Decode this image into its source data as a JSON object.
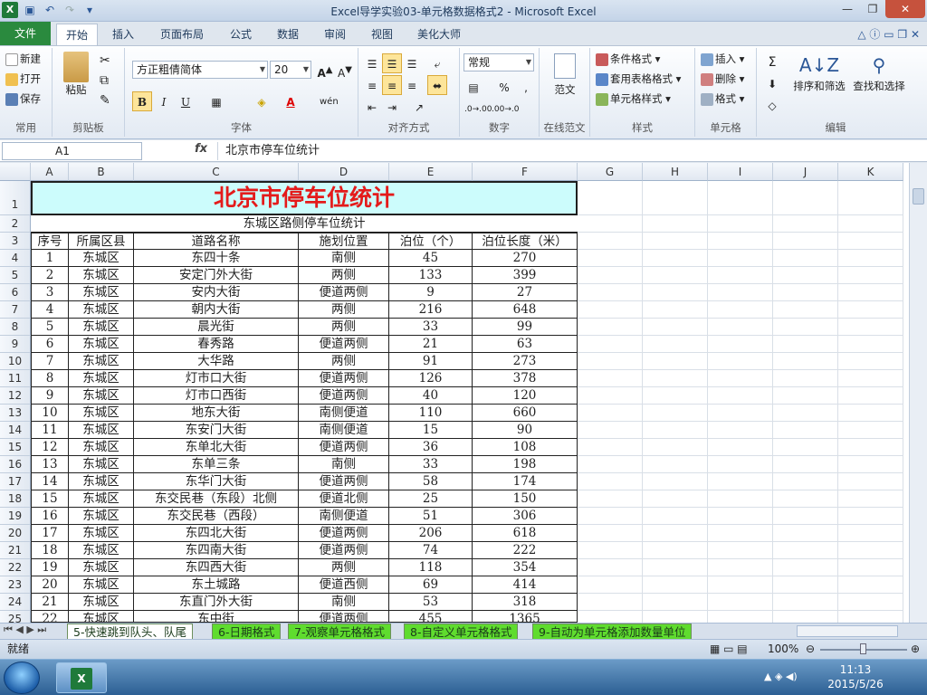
{
  "window": {
    "title": "Excel导学实验03-单元格数据格式2 - Microsoft Excel",
    "quick_access": [
      "save-icon",
      "undo-icon",
      "redo-icon",
      "customize-icon"
    ]
  },
  "tabs": [
    "文件",
    "开始",
    "插入",
    "页面布局",
    "公式",
    "数据",
    "审阅",
    "视图",
    "美化大师"
  ],
  "ribbon": {
    "clipboard": {
      "new": "新建",
      "open": "打开",
      "save": "保存",
      "paste": "粘贴",
      "label": "剪贴板",
      "common": "常用"
    },
    "font": {
      "name": "方正粗倩简体",
      "size": "20",
      "label": "字体",
      "bold": "B",
      "italic": "I",
      "underline": "U"
    },
    "alignment": {
      "label": "对齐方式"
    },
    "number": {
      "format": "常规",
      "label": "数字",
      "percent": "%",
      "comma": ","
    },
    "online": {
      "button": "范文",
      "label": "在线范文"
    },
    "styles": {
      "cond": "条件格式",
      "table": "套用表格格式",
      "cell": "单元格样式",
      "label": "样式"
    },
    "cells": {
      "insert": "插入",
      "delete": "删除",
      "format": "格式",
      "label": "单元格"
    },
    "editing": {
      "sort": "排序和筛选",
      "find": "查找和选择",
      "label": "编辑"
    }
  },
  "formula_bar": {
    "name_box": "A1",
    "fx": "fx",
    "content": "北京市停车位统计"
  },
  "columns": [
    "A",
    "B",
    "C",
    "D",
    "E",
    "F",
    "G",
    "H",
    "I",
    "J",
    "K"
  ],
  "sheet": {
    "title": "北京市停车位统计",
    "subtitle": "东城区路侧停车位统计",
    "headers": [
      "序号",
      "所属区县",
      "道路名称",
      "施划位置",
      "泊位（个）",
      "泊位长度（米）"
    ],
    "rows": [
      [
        "1",
        "东城区",
        "东四十条",
        "南侧",
        "45",
        "270"
      ],
      [
        "2",
        "东城区",
        "安定门外大街",
        "两侧",
        "133",
        "399"
      ],
      [
        "3",
        "东城区",
        "安内大街",
        "便道两侧",
        "9",
        "27"
      ],
      [
        "4",
        "东城区",
        "朝内大街",
        "两侧",
        "216",
        "648"
      ],
      [
        "5",
        "东城区",
        "晨光街",
        "两侧",
        "33",
        "99"
      ],
      [
        "6",
        "东城区",
        "春秀路",
        "便道两侧",
        "21",
        "63"
      ],
      [
        "7",
        "东城区",
        "大华路",
        "两侧",
        "91",
        "273"
      ],
      [
        "8",
        "东城区",
        "灯市口大街",
        "便道两侧",
        "126",
        "378"
      ],
      [
        "9",
        "东城区",
        "灯市口西街",
        "便道两侧",
        "40",
        "120"
      ],
      [
        "10",
        "东城区",
        "地东大街",
        "南侧便道",
        "110",
        "660"
      ],
      [
        "11",
        "东城区",
        "东安门大街",
        "南侧便道",
        "15",
        "90"
      ],
      [
        "12",
        "东城区",
        "东单北大街",
        "便道两侧",
        "36",
        "108"
      ],
      [
        "13",
        "东城区",
        "东单三条",
        "南侧",
        "33",
        "198"
      ],
      [
        "14",
        "东城区",
        "东华门大街",
        "便道两侧",
        "58",
        "174"
      ],
      [
        "15",
        "东城区",
        "东交民巷（东段）北侧",
        "便道北侧",
        "25",
        "150"
      ],
      [
        "16",
        "东城区",
        "东交民巷（西段）",
        "南侧便道",
        "51",
        "306"
      ],
      [
        "17",
        "东城区",
        "东四北大街",
        "便道两侧",
        "206",
        "618"
      ],
      [
        "18",
        "东城区",
        "东四南大街",
        "便道两侧",
        "74",
        "222"
      ],
      [
        "19",
        "东城区",
        "东四西大街",
        "两侧",
        "118",
        "354"
      ],
      [
        "20",
        "东城区",
        "东土城路",
        "便道西侧",
        "69",
        "414"
      ],
      [
        "21",
        "东城区",
        "东直门外大街",
        "南侧",
        "53",
        "318"
      ],
      [
        "22",
        "东城区",
        "东中街",
        "便道两侧",
        "455",
        "1365"
      ]
    ]
  },
  "sheet_tabs": [
    "5-快速跳到队头、队尾",
    "6-日期格式",
    "7-观察单元格格式",
    "8-自定义单元格格式",
    "9-自动为单元格添加数量单位"
  ],
  "status": {
    "ready": "就绪",
    "zoom": "100%"
  },
  "taskbar": {
    "time": "11:13",
    "date": "2015/5/26"
  }
}
